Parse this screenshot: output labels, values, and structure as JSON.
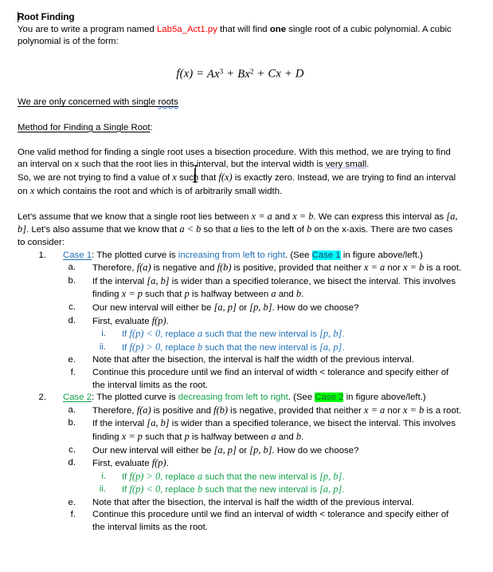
{
  "document": {
    "title": "Root Finding",
    "intro": {
      "before_filename": "You are to write a program named ",
      "filename": "Lab5a_Act1.py",
      "after_filename": " that will find ",
      "bold_word": "one",
      "tail": " single root of a cubic polynomial. A cubic polynomial is of the form:"
    },
    "equation": "f(x) =  Ax³ + Bx² + Cx + D",
    "equation_parts": {
      "lhs": "f(x) = ",
      "term1_base": "Ax",
      "term1_exp": "3",
      "term2_base": "Bx",
      "term2_exp": "2",
      "term3": "Cx",
      "term4": "D"
    },
    "note_single_roots": {
      "text_before": "We are only concerned with single ",
      "misspelled": "roots"
    },
    "method_heading": "Method for Finding a Single Root",
    "method_heading_colon": ":",
    "method_para": {
      "line1": "One valid method for finding a single root uses a bisection procedure. With this method, we are trying to find an interval on x such that the root lies in this interval, but the interval width is ",
      "grammar_flag": "very small",
      "line1_end": ".",
      "line2_a": "So, we are not trying to find a value of ",
      "line2_math1": "x",
      "line2_b": " such that ",
      "line2_math2": "f(x)",
      "line2_c": " is exactly zero. Instead, we are trying to find an interval on ",
      "line2_math3": "x",
      "line2_d": " which contains the root and which is of arbitrarily small width."
    },
    "assume_para": {
      "a": "Let’s assume that we know that a single root lies between ",
      "m1": "x = a",
      "b": " and ",
      "m2": "x = b",
      "c": ". We can express this interval as ",
      "m3": "[a, b]",
      "d": ". Let’s also assume that we know that ",
      "m4": "a < b",
      "e": " so that ",
      "m5": "a",
      "f": " lies to the left of ",
      "m6": "b",
      "g": " on the x-axis. There are two cases to consider:"
    },
    "cases": [
      {
        "marker": "1.",
        "label": "Case 1",
        "lead_after_label": ": The plotted curve is ",
        "direction": "increasing from left to right",
        "see_before": ". (See ",
        "highlight": "Case 1",
        "see_after": " in figure above/left.)",
        "color": "#1F6FB5",
        "highlight_color": "#00FFFF",
        "items": [
          {
            "marker": "a.",
            "parts": {
              "p1": "Therefore, ",
              "m1": "f(a)",
              "p2": " is negative and ",
              "m2": "f(b)",
              "p3": " is positive, provided that neither ",
              "m3": "x = a",
              "p4": " nor ",
              "m4": "x = b",
              "p5": " is a root."
            }
          },
          {
            "marker": "b.",
            "parts": {
              "p1": "If the interval ",
              "m1": "[a, b]",
              "p2": " is wider than a specified tolerance, we bisect the interval. This involves finding ",
              "m2": "x = p",
              "p3": " such that ",
              "m3": "p",
              "p4": " is halfway between ",
              "m4": "a",
              "p5": " and ",
              "m5": "b",
              "p6": "."
            }
          },
          {
            "marker": "c.",
            "parts": {
              "p1": "Our new interval will either be ",
              "m1": "[a, p]",
              "p2": " or ",
              "m2": "[p, b]",
              "p3": ". How do we choose?"
            }
          },
          {
            "marker": "d.",
            "parts": {
              "p1": "First, evaluate ",
              "m1": "f(p)",
              "p2": "."
            }
          }
        ],
        "subitems": [
          {
            "marker": "i.",
            "parts": {
              "p1": "If ",
              "m1": "f(p) < 0",
              "p2": ", replace ",
              "m2": "a",
              "p3": " such that the new interval is ",
              "m3": "[p, b]",
              "p4": "."
            }
          },
          {
            "marker": "ii.",
            "parts": {
              "p1": "If ",
              "m1": "f(p) > 0",
              "p2": ", replace ",
              "m2": "b",
              "p3": " such that the new interval is ",
              "m3": "[a, p]",
              "p4": "."
            }
          }
        ],
        "tail_items": [
          {
            "marker": "e.",
            "text": "Note that after the bisection, the interval is half the width of the previous interval."
          },
          {
            "marker": "f.",
            "text": "Continue this procedure until we find an interval of width < tolerance and specify either of the interval limits as the root."
          }
        ]
      },
      {
        "marker": "2.",
        "label": "Case 2",
        "lead_after_label": ": The plotted curve is ",
        "direction": "decreasing from left to right",
        "see_before": ". (See ",
        "highlight": "Case 2",
        "see_after": " in figure above/left.)",
        "color": "#12A04A",
        "highlight_color": "#00FF00",
        "items": [
          {
            "marker": "a.",
            "parts": {
              "p1": "Therefore, ",
              "m1": "f(a)",
              "p2": " is positive and ",
              "m2": "f(b)",
              "p3": " is negative, provided that neither ",
              "m3": "x = a",
              "p4": " nor ",
              "m4": "x = b",
              "p5": " is a root."
            }
          },
          {
            "marker": "b.",
            "parts": {
              "p1": "If the interval ",
              "m1": "[a, b]",
              "p2": " is wider than a specified tolerance, we bisect the interval. This involves finding ",
              "m2": "x = p",
              "p3": " such that ",
              "m3": "p",
              "p4": " is halfway between ",
              "m4": "a",
              "p5": " and ",
              "m5": "b",
              "p6": "."
            }
          },
          {
            "marker": "c.",
            "parts": {
              "p1": "Our new interval will either be ",
              "m1": "[a, p]",
              "p2": " or ",
              "m2": "[p, b]",
              "p3": ". How do we choose?"
            }
          },
          {
            "marker": "d.",
            "parts": {
              "p1": "First, evaluate ",
              "m1": "f(p)",
              "p2": "."
            }
          }
        ],
        "subitems": [
          {
            "marker": "i.",
            "parts": {
              "p1": "If ",
              "m1": "f(p) > 0",
              "p2": ", replace ",
              "m2": "a",
              "p3": " such that the new interval is ",
              "m3": "[p, b]",
              "p4": "."
            }
          },
          {
            "marker": "ii.",
            "parts": {
              "p1": "If ",
              "m1": "f(p) < 0",
              "p2": ", replace ",
              "m2": "b",
              "p3": " such that the new interval is ",
              "m3": "[a, p]",
              "p4": "."
            }
          }
        ],
        "tail_items": [
          {
            "marker": "e.",
            "text": "Note that after the bisection, the interval is half the width of the previous interval."
          },
          {
            "marker": "f.",
            "text": "Continue this procedure until we find an interval of width < tolerance and specify either of the interval limits as the root."
          }
        ]
      }
    ]
  }
}
